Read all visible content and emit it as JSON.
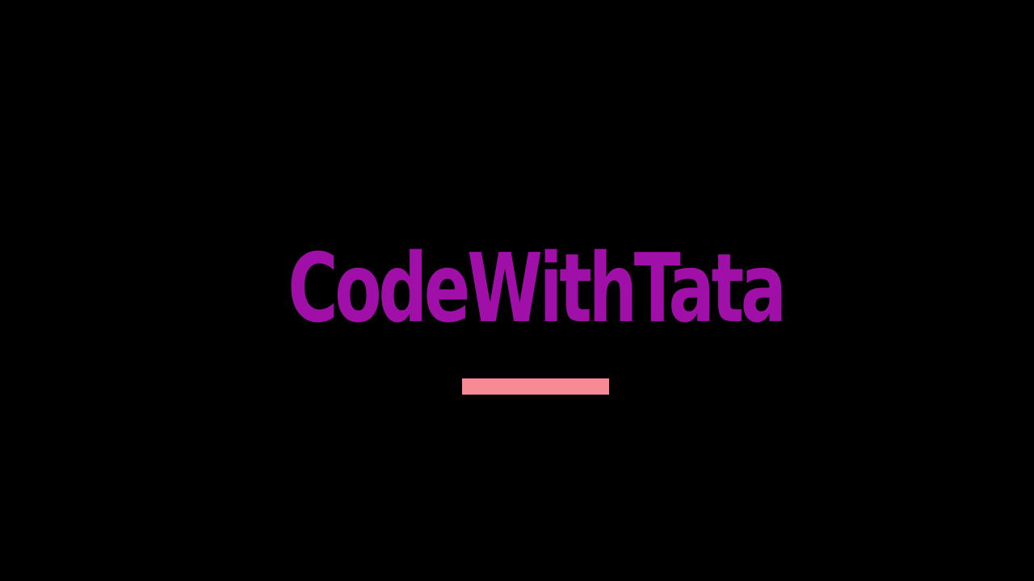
{
  "title": "CodeWithTata",
  "colors": {
    "background": "#000000",
    "title": "#a010a8",
    "underline": "#f78a94"
  }
}
